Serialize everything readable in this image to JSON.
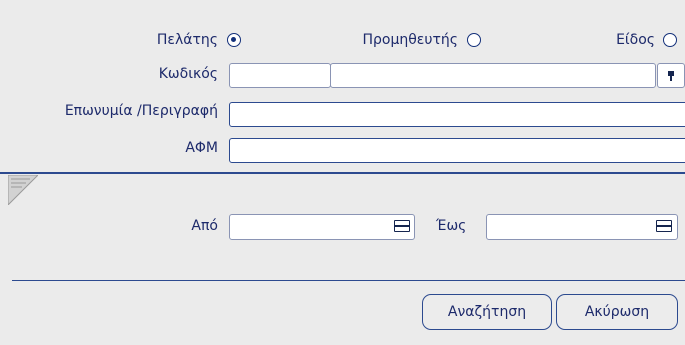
{
  "filters": {
    "type_radio": {
      "customer_label": "Πελάτης",
      "supplier_label": "Προμηθευτής",
      "item_label": "Είδος",
      "selected": "customer"
    },
    "code_label": "Κωδικός",
    "code_value_1": "",
    "code_value_2": "",
    "name_label": "Επωνυμία /Περιγραφή",
    "name_value": "",
    "vat_label": "ΑΦΜ",
    "vat_value": ""
  },
  "date_range": {
    "from_label": "Από",
    "from_value": "",
    "to_label": "Έως",
    "to_value": ""
  },
  "actions": {
    "search_label": "Αναζήτηση",
    "cancel_label": "Ακύρωση"
  },
  "colors": {
    "background": "#ebebeb",
    "accent": "#2c4a8f",
    "text": "#1d2a6b"
  },
  "icons": {
    "collapse": "collapse-corner-icon",
    "calendar": "calendar-icon",
    "lookup": "lookup-icon"
  }
}
